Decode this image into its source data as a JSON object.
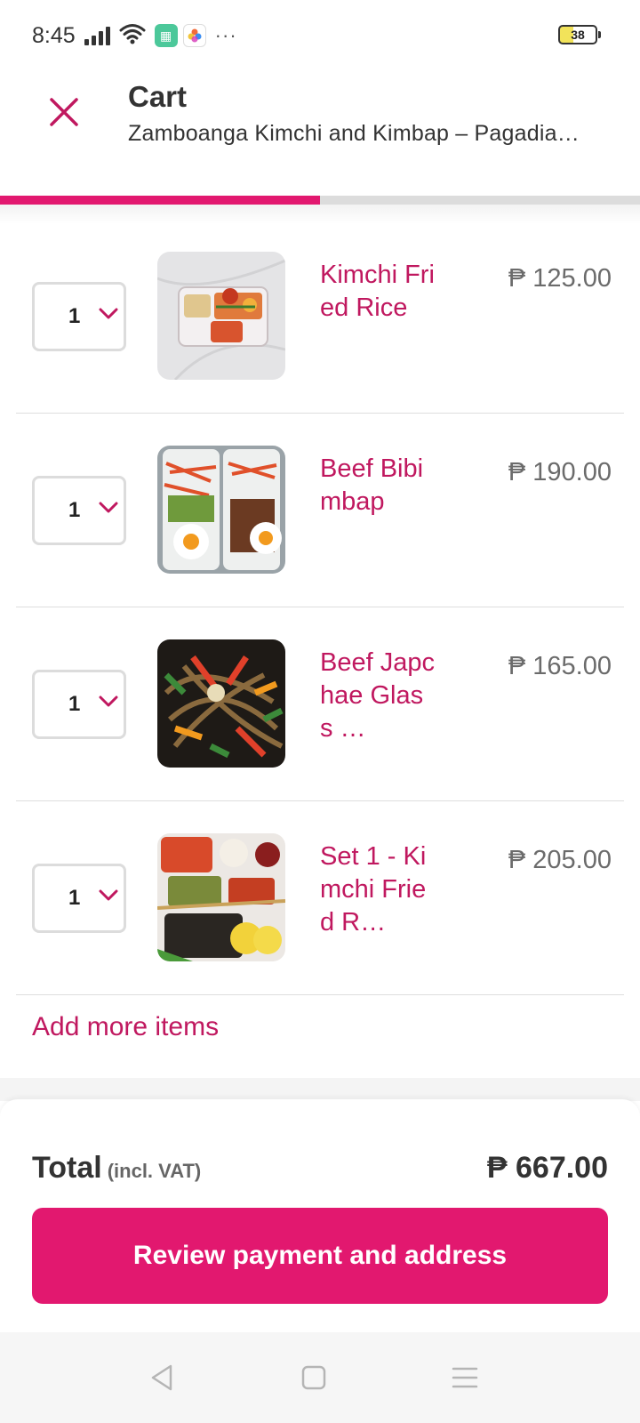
{
  "status_bar": {
    "time": "8:45",
    "battery": "38",
    "more_indicator": "···",
    "icons": [
      "signal-icon",
      "wifi-icon",
      "calculator-app-icon",
      "photos-app-icon"
    ]
  },
  "header": {
    "title": "Cart",
    "subtitle": "Zamboanga Kimchi and Kimbap – Pagadia…",
    "close_icon": "close-icon",
    "progress_fraction": 0.5
  },
  "items": [
    {
      "qty": "1",
      "name": "Kimchi Fried Rice",
      "price": "₱ 125.00"
    },
    {
      "qty": "1",
      "name": "Beef Bibimbap",
      "price": "₱ 190.00"
    },
    {
      "qty": "1",
      "name": "Beef Japchae Glass …",
      "price": "₱ 165.00"
    },
    {
      "qty": "1",
      "name": "Set 1 - Kimchi Fried R…",
      "price": "₱ 205.00"
    }
  ],
  "add_more": "Add more items",
  "summary": {
    "total_label": "Total",
    "total_note": "(incl. VAT)",
    "total_value": "₱ 667.00"
  },
  "cta": {
    "label": "Review payment and address"
  },
  "nav": {
    "icons": [
      "back-icon",
      "home-icon",
      "menu-icon"
    ]
  },
  "colors": {
    "accent": "#e2186f",
    "item_name": "#c0185f",
    "price": "#6b6b6b"
  }
}
